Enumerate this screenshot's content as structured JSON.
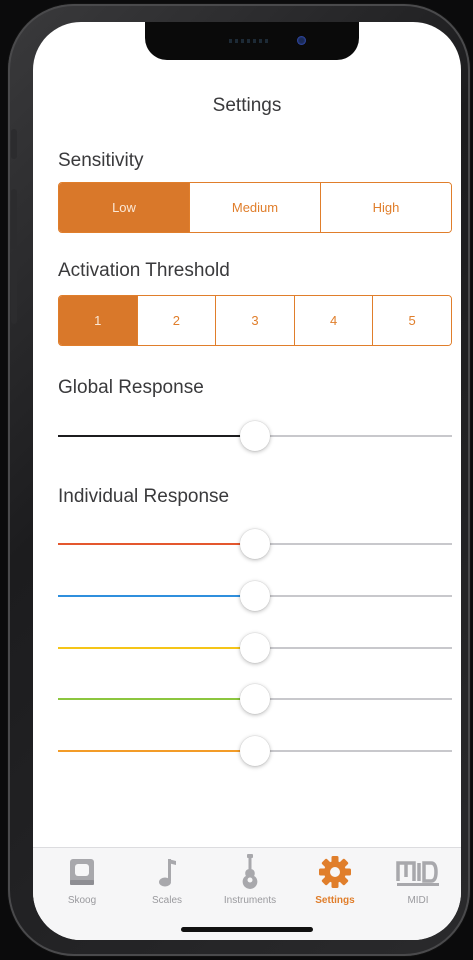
{
  "header": {
    "title": "Settings"
  },
  "sensitivity": {
    "label": "Sensitivity",
    "options": [
      "Low",
      "Medium",
      "High"
    ],
    "selected": "Low"
  },
  "activation": {
    "label": "Activation Threshold",
    "options": [
      "1",
      "2",
      "3",
      "4",
      "5"
    ],
    "selected": "1"
  },
  "global_response": {
    "label": "Global Response",
    "value": 0.5,
    "color": "#1c1c1e"
  },
  "individual_response": {
    "label": "Individual Response",
    "sliders": [
      {
        "color": "#e4572e",
        "value": 0.5
      },
      {
        "color": "#2f8fdd",
        "value": 0.5
      },
      {
        "color": "#f5c518",
        "value": 0.5
      },
      {
        "color": "#8cc63f",
        "value": 0.5
      },
      {
        "color": "#f39c28",
        "value": 0.5
      }
    ]
  },
  "tabbar": {
    "tabs": [
      {
        "label": "Skoog",
        "icon": "skoog-cube-icon"
      },
      {
        "label": "Scales",
        "icon": "music-note-icon"
      },
      {
        "label": "Instruments",
        "icon": "guitar-icon"
      },
      {
        "label": "Settings",
        "icon": "gear-icon"
      },
      {
        "label": "MIDI",
        "icon": "midi-icon"
      }
    ],
    "active": "Settings",
    "active_color": "#e07e2b",
    "inactive_color": "#a2a2a6"
  }
}
